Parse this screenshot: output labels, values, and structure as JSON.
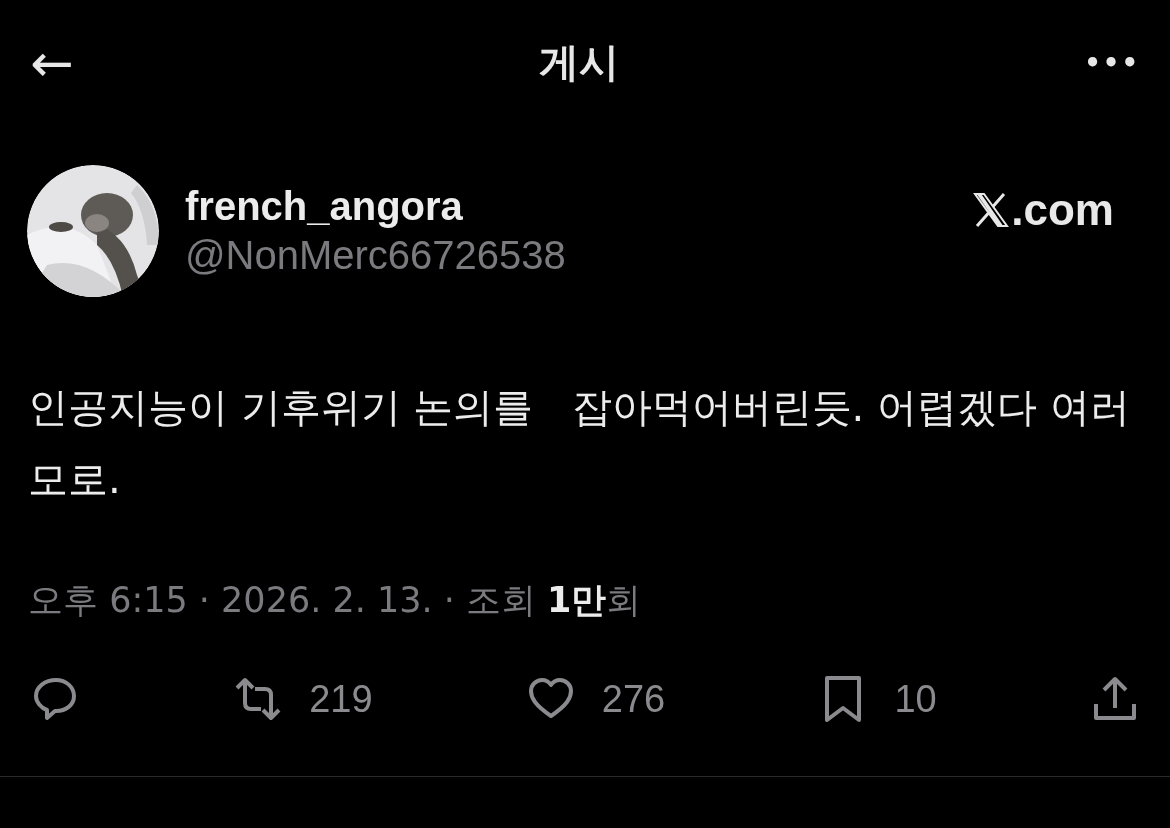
{
  "header": {
    "back": "←",
    "title": "게시",
    "more": "•••"
  },
  "author": {
    "name": "french_angora",
    "handle": "@NonMerc66726538",
    "source": ".com"
  },
  "post": {
    "text": "인공지능이 기후위기 논의를   잡아먹어버린듯. 어렵겠다 여러모로."
  },
  "meta": "오후 6:15 · 2026. 2. 13. · 조회 **1만**회",
  "actions": [
    {
      "kind": "reply"
    },
    {
      "kind": "repost",
      "count": "219"
    },
    {
      "kind": "like",
      "count": "276"
    },
    {
      "kind": "bookmark",
      "count": "10"
    },
    {
      "kind": "share"
    }
  ]
}
